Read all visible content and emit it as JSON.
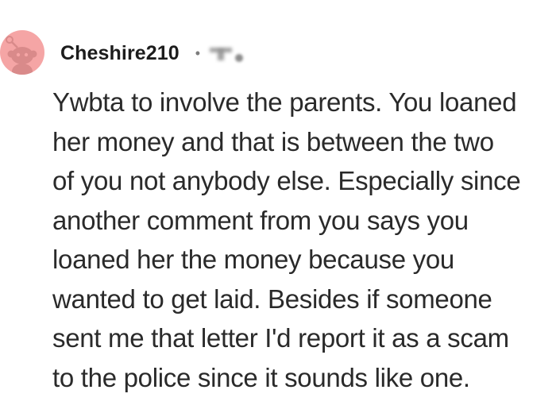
{
  "comment": {
    "username": "Cheshire210",
    "separator": "•",
    "body_lines": [
      "Ywbta to involve the parents. You loaned",
      "her money and that is between the two",
      "of you not anybody else. Especially since",
      "another comment from you says you",
      "loaned her the money because you",
      "wanted to get laid. Besides if someone",
      "sent me that letter I'd report it as a scam",
      "to the police since it sounds like one."
    ]
  },
  "colors": {
    "avatar_bg": "#f5a5a5",
    "avatar_fg": "#d98a8a",
    "text": "#2a2a2a",
    "username": "#1c1c1c"
  },
  "icons": {
    "avatar": "snoo-avatar-icon"
  }
}
